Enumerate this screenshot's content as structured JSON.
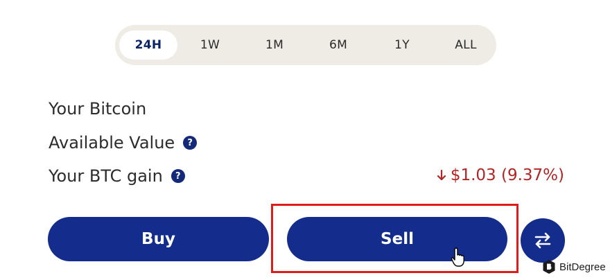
{
  "time_range": {
    "tabs": [
      "24H",
      "1W",
      "1M",
      "6M",
      "1Y",
      "ALL"
    ],
    "active": "24H"
  },
  "holdings": {
    "your_bitcoin_label": "Your Bitcoin",
    "available_value_label": "Available Value",
    "btc_gain_label": "Your BTC gain",
    "btc_gain_value": "$1.03 (9.37%)",
    "help_glyph": "?"
  },
  "actions": {
    "buy_label": "Buy",
    "sell_label": "Sell",
    "swap_icon": "swap-arrows-icon"
  },
  "watermark": {
    "text": "BitDegree",
    "icon": "bitdegree-logo-icon"
  },
  "colors": {
    "primary": "#142d8c",
    "loss": "#b32424",
    "highlight": "#e01b1b",
    "pill_bg": "#efece6"
  }
}
